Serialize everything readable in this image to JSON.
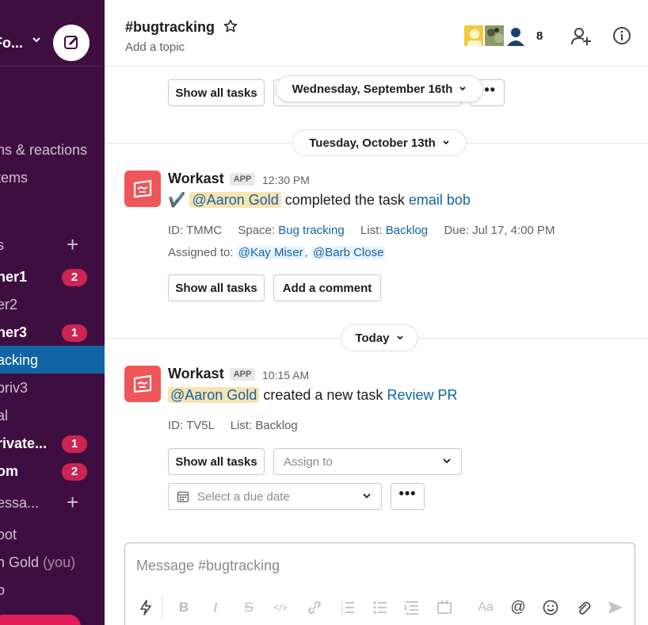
{
  "workspace": {
    "name": "Fo...",
    "chev": "⌄"
  },
  "sidebar": {
    "items": [
      {
        "label": "ns & reactions"
      },
      {
        "label": "tems"
      },
      {
        "label": "s"
      },
      {
        "label": "ner1",
        "badge": "2"
      },
      {
        "label": "er2"
      },
      {
        "label": "ner3",
        "badge": "1"
      },
      {
        "label": "acking"
      },
      {
        "label": "priv3"
      },
      {
        "label": "al"
      },
      {
        "label": "rivate...",
        "badge": "1"
      },
      {
        "label": "om",
        "badge": "2"
      },
      {
        "label": "essa..."
      },
      {
        "label": "oot"
      },
      {
        "label": "n Gold",
        "you": "(you)"
      },
      {
        "label": "o"
      }
    ]
  },
  "header": {
    "title": "#bugtracking",
    "topic": "Add a topic",
    "member_count": "8"
  },
  "messages": {
    "top_buttons": {
      "show_all": "Show all tasks",
      "date_float": "Wednesday, September 16th",
      "dots": "•••"
    },
    "date1": "Tuesday, October 13th",
    "msg1": {
      "sender": "Workast",
      "badge": "APP",
      "time": "12:30 PM",
      "check": "✔️",
      "mention": "@Aaron Gold",
      "text": "completed the task",
      "task": "email bob",
      "id_label": "ID:",
      "id_value": "TMMC",
      "space_label": "Space:",
      "space_value": "Bug tracking",
      "list_label": "List:",
      "list_value": "Backlog",
      "due_label": "Due:",
      "due_value": "Jul 17, 4:00 PM",
      "assigned_label": "Assigned to:",
      "assignee1": "@Kay Miser",
      "comma": ",",
      "assignee2": "@Barb Close",
      "show_all": "Show all tasks",
      "add_comment": "Add a comment"
    },
    "date2": "Today",
    "msg2": {
      "sender": "Workast",
      "badge": "APP",
      "time": "10:15 AM",
      "mention": "@Aaron Gold",
      "text": "created a new task",
      "task": "Review PR",
      "id_label": "ID:",
      "id_value": "TV5L",
      "list_label": "List:",
      "list_value": "Backlog",
      "show_all": "Show all tasks",
      "assign_placeholder": "Assign to",
      "due_placeholder": "Select a due date",
      "dots": "•••"
    }
  },
  "composer": {
    "placeholder": "Message #bugtracking",
    "format_icons": [
      "lightning-icon",
      "bold-icon",
      "italic-icon",
      "strike-icon",
      "code-icon",
      "link-icon",
      "ordered-list-icon",
      "bullet-list-icon",
      "indent-icon",
      "code-block-icon",
      "text-format-icon",
      "mention-icon",
      "emoji-icon",
      "attach-icon",
      "send-icon"
    ],
    "labels": {
      "bold": "B",
      "italic": "I",
      "strike": "S",
      "code": "</>",
      "aa": "Aa",
      "at": "@"
    }
  },
  "colors": {
    "sidebar_bg": "#3f0e40",
    "active_item": "#1164a3",
    "badge": "#cd2553",
    "app_avatar": "#f0555a",
    "link": "#1264a3",
    "mention_bg": "#f8e3b1"
  }
}
